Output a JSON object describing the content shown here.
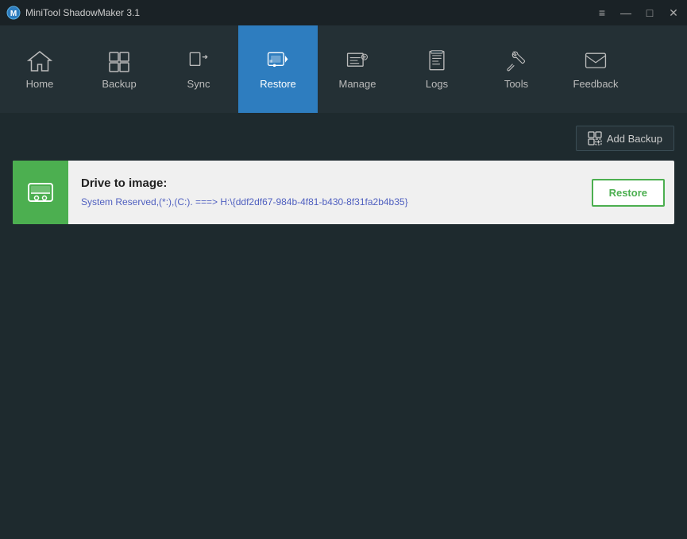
{
  "titlebar": {
    "app_name": "MiniTool ShadowMaker 3.1",
    "controls": {
      "menu": "≡",
      "minimize": "—",
      "maximize": "□",
      "close": "✕"
    }
  },
  "navbar": {
    "items": [
      {
        "id": "home",
        "label": "Home",
        "active": false
      },
      {
        "id": "backup",
        "label": "Backup",
        "active": false
      },
      {
        "id": "sync",
        "label": "Sync",
        "active": false
      },
      {
        "id": "restore",
        "label": "Restore",
        "active": true
      },
      {
        "id": "manage",
        "label": "Manage",
        "active": false
      },
      {
        "id": "logs",
        "label": "Logs",
        "active": false
      },
      {
        "id": "tools",
        "label": "Tools",
        "active": false
      },
      {
        "id": "feedback",
        "label": "Feedback",
        "active": false
      }
    ]
  },
  "toolbar": {
    "add_backup_label": "Add Backup"
  },
  "restore_card": {
    "title": "Drive to image:",
    "path": "System Reserved,(*:),(C:). ===> H:\\{ddf2df67-984b-4f81-b430-8f31fa2b4b35}",
    "restore_button": "Restore"
  }
}
